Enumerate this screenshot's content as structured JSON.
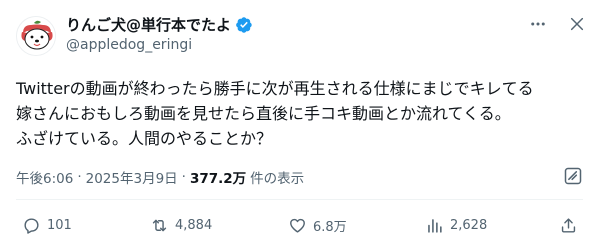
{
  "author": {
    "display_name": "りんご犬@単行本でたよ",
    "handle": "@appledog_eringi",
    "verified": true
  },
  "tweet": {
    "lines": [
      "Twitterの動画が終わったら勝手に次が再生される仕様にまじでキレてる",
      "嫁さんにおもしろ動画を見せたら直後に手コキ動画とか流れてくる。",
      "ふざけている。人間のやることか？"
    ]
  },
  "meta": {
    "time": "午後6:06",
    "separator": "·",
    "date": "2025年3月9日",
    "views_count": "377.2万",
    "views_label": "件の表示"
  },
  "actions": {
    "replies": "101",
    "retweets": "4,884",
    "likes": "6.8万",
    "bookmarks": "2,628"
  },
  "icons": {
    "verified": "verified-badge-icon",
    "more": "more-horizontal-icon",
    "close": "close-icon",
    "grok": "grok-icon",
    "reply": "reply-icon",
    "retweet": "retweet-icon",
    "like": "heart-icon",
    "views": "views-chart-icon",
    "share": "share-icon"
  },
  "colors": {
    "text": "#0f1419",
    "muted": "#536471",
    "verified": "#1d9bf0",
    "divider": "#eff3f4",
    "avatar_red": "#d84a4a"
  }
}
